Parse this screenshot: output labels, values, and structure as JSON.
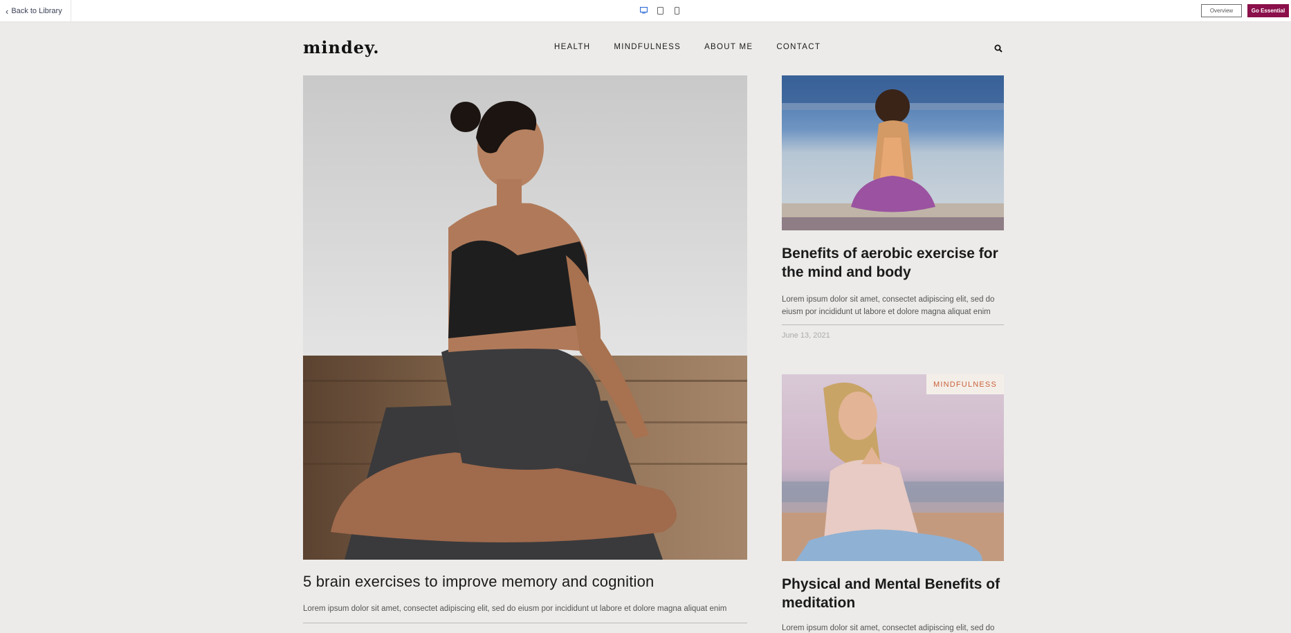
{
  "toolbar": {
    "back_label": "Back to Library",
    "overview_label": "Overview",
    "go_label": "Go Essential",
    "active_color": "#2d6bd6",
    "go_color": "#8a0f4a"
  },
  "site": {
    "logo": "mindey.",
    "nav": [
      "HEALTH",
      "MINDFULNESS",
      "ABOUT ME",
      "CONTACT"
    ]
  },
  "hero": {
    "title": "5 brain exercises to improve memory and cognition",
    "excerpt": "Lorem ipsum dolor sit amet, consectet adipiscing elit, sed do eiusm por incididunt ut labore et dolore magna aliquat enim"
  },
  "cards": [
    {
      "title": "Benefits of aerobic exercise for the mind and body",
      "excerpt": "Lorem ipsum dolor sit amet, consectet adipiscing elit, sed do eiusm por incididunt ut labore et dolore magna aliquat enim",
      "date": "June 13, 2021"
    },
    {
      "badge": "MINDFULNESS",
      "title": "Physical and Mental Benefits of meditation",
      "excerpt": "Lorem ipsum dolor sit amet, consectet adipiscing elit, sed do"
    }
  ]
}
